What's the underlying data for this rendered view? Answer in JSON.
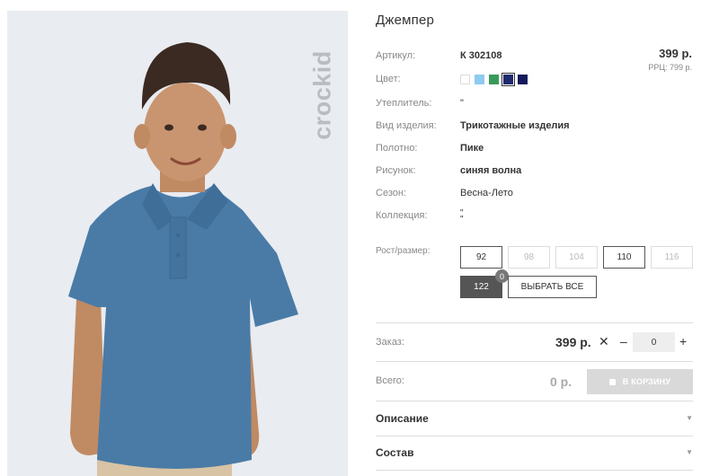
{
  "product": {
    "title": "Джемпер",
    "brand": "crockid",
    "price": "399 р.",
    "rrp": "РРЦ: 799 р."
  },
  "attributes": [
    {
      "label": "Артикул:",
      "value": "К 302108"
    },
    {
      "label": "Цвет:",
      "value": ""
    },
    {
      "label": "Утеплитель:",
      "value": "\""
    },
    {
      "label": "Вид изделия:",
      "value": "Трикотажные изделия"
    },
    {
      "label": "Полотно:",
      "value": "Пике"
    },
    {
      "label": "Рисунок:",
      "value": "синяя волна"
    },
    {
      "label": "Сезон:",
      "value": "Весна-Лето"
    },
    {
      "label": "Коллекция:",
      "value": "\"\n\""
    }
  ],
  "colors": [
    {
      "name": "white-swatch",
      "hex": "#ffffff",
      "selected": false
    },
    {
      "name": "light-blue-swatch",
      "hex": "#8fcbf0",
      "selected": false
    },
    {
      "name": "green-swatch",
      "hex": "#3a9a5b",
      "selected": false
    },
    {
      "name": "navy-swatch",
      "hex": "#1f2a6e",
      "selected": true
    },
    {
      "name": "dark-navy-swatch",
      "hex": "#151a5c",
      "selected": false
    }
  ],
  "sizes": {
    "label": "Рост/размер:",
    "items": [
      {
        "label": "92",
        "state": "available"
      },
      {
        "label": "98",
        "state": "disabled"
      },
      {
        "label": "104",
        "state": "disabled"
      },
      {
        "label": "110",
        "state": "available"
      },
      {
        "label": "116",
        "state": "disabled"
      },
      {
        "label": "122",
        "state": "active",
        "count": "0"
      }
    ],
    "select_all_label": "ВЫБРАТЬ ВСЕ"
  },
  "order": {
    "label": "Заказ:",
    "price": "399 р.",
    "times": "✕",
    "minus": "–",
    "plus": "+",
    "quantity": "0"
  },
  "total": {
    "label": "Всего:",
    "value": "0 р.",
    "cart_label": "В КОРЗИНУ"
  },
  "accordions": [
    {
      "label": "Описание",
      "chevron": "▼"
    },
    {
      "label": "Состав",
      "chevron": "▼"
    }
  ],
  "theme": {
    "shirt_color": "#4a7ba6",
    "photo_bg": "#e9ecf0"
  }
}
